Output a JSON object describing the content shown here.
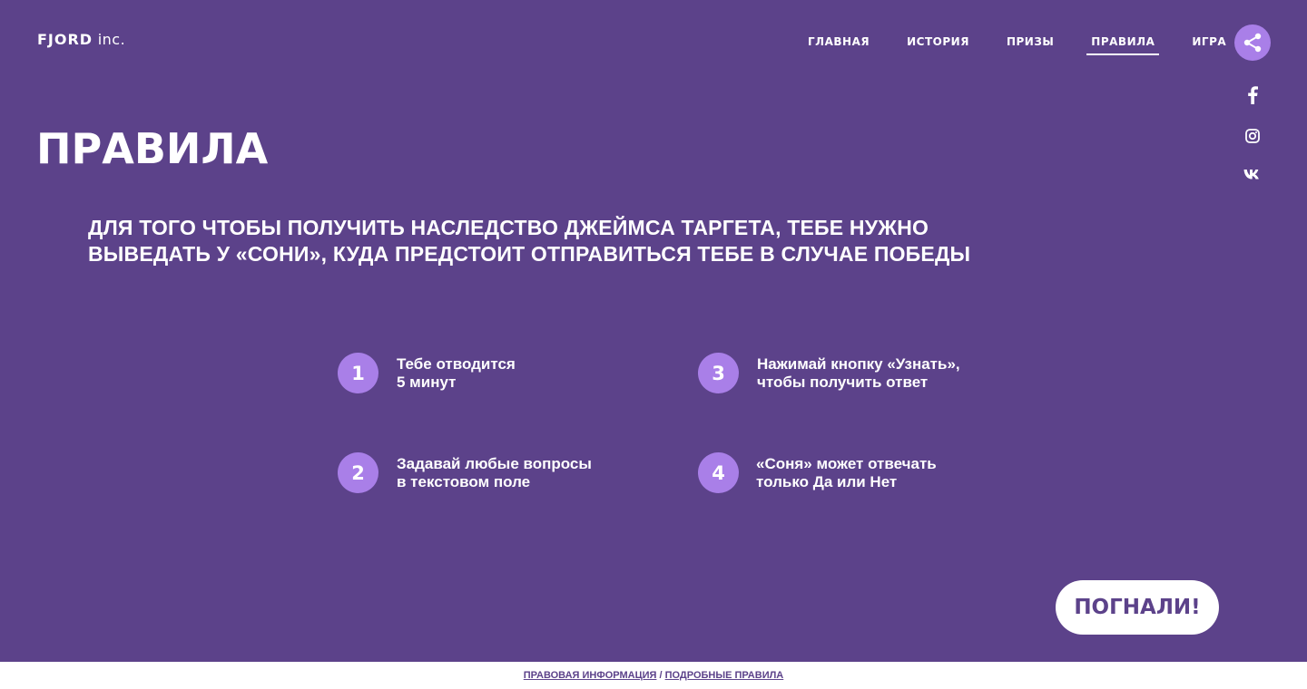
{
  "header": {
    "logo_brand": "FJORD",
    "logo_suffix": "inc.",
    "nav": [
      {
        "label": "ГЛАВНАЯ"
      },
      {
        "label": "ИСТОРИЯ"
      },
      {
        "label": "ПРИЗЫ"
      },
      {
        "label": "ПРАВИЛА",
        "active": true
      },
      {
        "label": "ИГРА"
      }
    ]
  },
  "social": {
    "share_icon": "share-icon",
    "items": [
      "facebook-icon",
      "instagram-icon",
      "vk-icon"
    ]
  },
  "main": {
    "title": "ПРАВИЛА",
    "intro": "ДЛЯ ТОГО ЧТОБЫ ПОЛУЧИТЬ НАСЛЕДСТВО ДЖЕЙМСА ТАРГЕТА, ТЕБЕ НУЖНО ВЫВЕДАТЬ У «СОНИ», КУДА ПРЕДСТОИТ ОТПРАВИТЬСЯ ТЕБЕ В СЛУЧАЕ ПОБЕДЫ",
    "rules": [
      {
        "number": "1",
        "line1": "Тебе отводится",
        "line2": "5 минут"
      },
      {
        "number": "2",
        "line1": "Задавай любые вопросы",
        "line2": "в текстовом поле"
      },
      {
        "number": "3",
        "line1": "Нажимай кнопку «Узнать»,",
        "line2": "чтобы получить ответ"
      },
      {
        "number": "4",
        "line1": "«Соня» может отвечать",
        "line2": "только Да или Нет"
      }
    ],
    "cta_label": "ПОГНАЛИ!"
  },
  "footer": {
    "legal_link": "ПРАВОВАЯ ИНФОРМАЦИЯ",
    "separator": " / ",
    "rules_link": "ПОДРОБНЫЕ ПРАВИЛА"
  },
  "colors": {
    "background": "#5c428a",
    "accent": "#a97fe8",
    "text": "#ffffff"
  }
}
